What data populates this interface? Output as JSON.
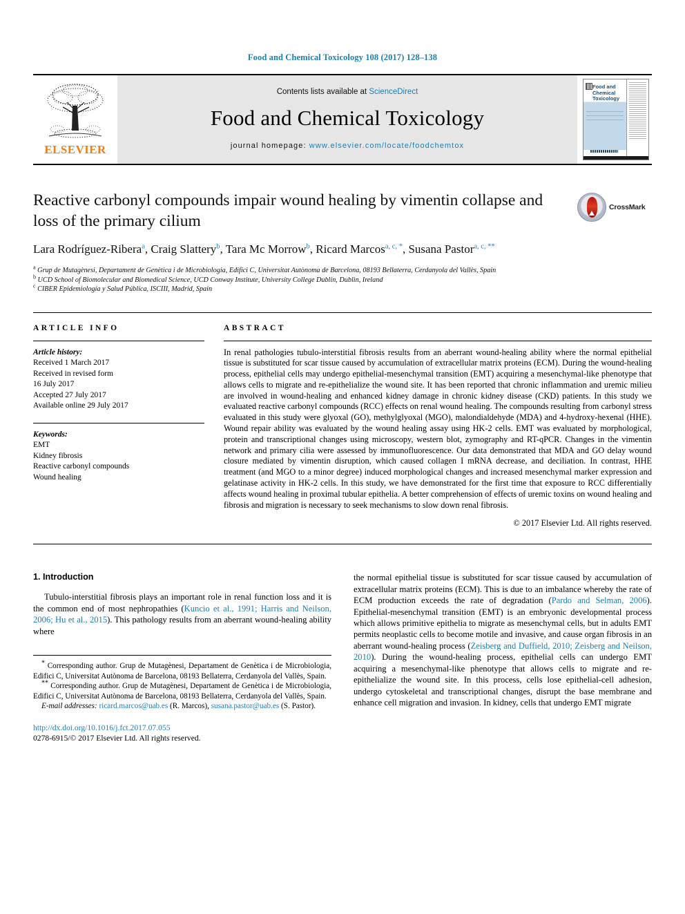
{
  "running_head": "Food and Chemical Toxicology 108 (2017) 128–138",
  "masthead": {
    "publisher": "ELSEVIER",
    "contents_prefix": "Contents lists available at ",
    "contents_link": "ScienceDirect",
    "journal_title": "Food and Chemical Toxicology",
    "homepage_prefix": "journal homepage: ",
    "homepage_url": "www.elsevier.com/locate/foodchemtox",
    "cover_title_line1": "Food and",
    "cover_title_line2": "Chemical",
    "cover_title_line3": "Toxicology"
  },
  "article": {
    "title": "Reactive carbonyl compounds impair wound healing by vimentin collapse and loss of the primary cilium",
    "crossmark_label": "CrossMark",
    "authors": [
      {
        "name": "Lara Rodríguez-Ribera",
        "marks": "a"
      },
      {
        "name": "Craig Slattery",
        "marks": "b"
      },
      {
        "name": "Tara Mc Morrow",
        "marks": "b"
      },
      {
        "name": "Ricard Marcos",
        "marks": "a, c, *"
      },
      {
        "name": "Susana Pastor",
        "marks": "a, c, **"
      }
    ],
    "affiliations": [
      {
        "mark": "a",
        "text": "Grup de Mutagènesi, Departament de Genètica i de Microbiologia, Edifici C, Universitat Autònoma de Barcelona, 08193 Bellaterra, Cerdanyola del Vallès, Spain"
      },
      {
        "mark": "b",
        "text": "UCD School of Biomolecular and Biomedical Science, UCD Conway Institute, University College Dublin, Dublin, Ireland"
      },
      {
        "mark": "c",
        "text": "CIBER Epidemiología y Salud Pública, ISCIII, Madrid, Spain"
      }
    ]
  },
  "article_info": {
    "heading": "ARTICLE INFO",
    "history_label": "Article history:",
    "history": [
      "Received 1 March 2017",
      "Received in revised form",
      "16 July 2017",
      "Accepted 27 July 2017",
      "Available online 29 July 2017"
    ],
    "keywords_label": "Keywords:",
    "keywords": [
      "EMT",
      "Kidney fibrosis",
      "Reactive carbonyl compounds",
      "Wound healing"
    ]
  },
  "abstract": {
    "heading": "ABSTRACT",
    "text": "In renal pathologies tubulo-interstitial fibrosis results from an aberrant wound-healing ability where the normal epithelial tissue is substituted for scar tissue caused by accumulation of extracellular matrix proteins (ECM). During the wound-healing process, epithelial cells may undergo epithelial-mesenchymal transition (EMT) acquiring a mesenchymal-like phenotype that allows cells to migrate and re-epithelialize the wound site. It has been reported that chronic inflammation and uremic milieu are involved in wound-healing and enhanced kidney damage in chronic kidney disease (CKD) patients. In this study we evaluated reactive carbonyl compounds (RCC) effects on renal wound healing. The compounds resulting from carbonyl stress evaluated in this study were glyoxal (GO), methylglyoxal (MGO), malondialdehyde (MDA) and 4-hydroxy-hexenal (HHE). Wound repair ability was evaluated by the wound healing assay using HK-2 cells. EMT was evaluated by morphological, protein and transcriptional changes using microscopy, western blot, zymography and RT-qPCR. Changes in the vimentin network and primary cilia were assessed by immunofluorescence. Our data demonstrated that MDA and GO delay wound closure mediated by vimentin disruption, which caused collagen I mRNA decrease, and deciliation. In contrast, HHE treatment (and MGO to a minor degree) induced morphological changes and increased mesenchymal marker expression and gelatinase activity in HK-2 cells. In this study, we have demonstrated for the first time that exposure to RCC differentially affects wound healing in proximal tubular epithelia. A better comprehension of effects of uremic toxins on wound healing and fibrosis and migration is necessary to seek mechanisms to slow down renal fibrosis.",
    "copyright": "© 2017 Elsevier Ltd. All rights reserved."
  },
  "introduction": {
    "heading": "1. Introduction",
    "left_p1_a": "Tubulo-interstitial fibrosis plays an important role in renal function loss and it is the common end of most nephropathies (",
    "left_p1_cite": "Kuncio et al., 1991; Harris and Neilson, 2006; Hu et al., 2015",
    "left_p1_b": "). This pathology results from an aberrant wound-healing ability where",
    "right_p1_a": "the normal epithelial tissue is substituted for scar tissue caused by accumulation of extracellular matrix proteins (ECM). This is due to an imbalance whereby the rate of ECM production exceeds the rate of degradation (",
    "right_cite1": "Pardo and Selman, 2006",
    "right_p1_b": "). Epithelial-mesenchymal transition (EMT) is an embryonic developmental process which allows primitive epithelia to migrate as mesenchymal cells, but in adults EMT permits neoplastic cells to become motile and invasive, and cause organ fibrosis in an aberrant wound-healing process (",
    "right_cite2": "Zeisberg and Duffield, 2010; Zeisberg and Neilson, 2010",
    "right_p1_c": "). During the wound-healing process, epithelial cells can undergo EMT acquiring a mesenchymal-like phenotype that allows cells to migrate and re-epithelialize the wound site. In this process, cells lose epithelial-cell adhesion, undergo cytoskeletal and transcriptional changes, disrupt the base membrane and enhance cell migration and invasion. In kidney, cells that undergo EMT migrate"
  },
  "footnotes": {
    "corresponding_1_mark": "*",
    "corresponding_1": "Corresponding author. Grup de Mutagènesi, Departament de Genètica i de Microbiologia, Edifici C, Universitat Autònoma de Barcelona, 08193 Bellaterra, Cerdanyola del Vallès, Spain.",
    "corresponding_2_mark": "**",
    "corresponding_2": "Corresponding author. Grup de Mutagènesi, Departament de Genètica i de Microbiologia, Edifici C, Universitat Autònoma de Barcelona, 08193 Bellaterra, Cerdanyola del Vallès, Spain.",
    "email_label": "E-mail addresses:",
    "email_1": "ricard.marcos@uab.es",
    "email_1_owner": "(R. Marcos),",
    "email_2": "susana.pastor@uab.es",
    "email_2_owner": "(S. Pastor)."
  },
  "footer": {
    "doi": "http://dx.doi.org/10.1016/j.fct.2017.07.055",
    "issn_line": "0278-6915/© 2017 Elsevier Ltd. All rights reserved."
  },
  "colors": {
    "link_blue": "#1a7fb5",
    "elsevier_orange": "#f07f13"
  }
}
